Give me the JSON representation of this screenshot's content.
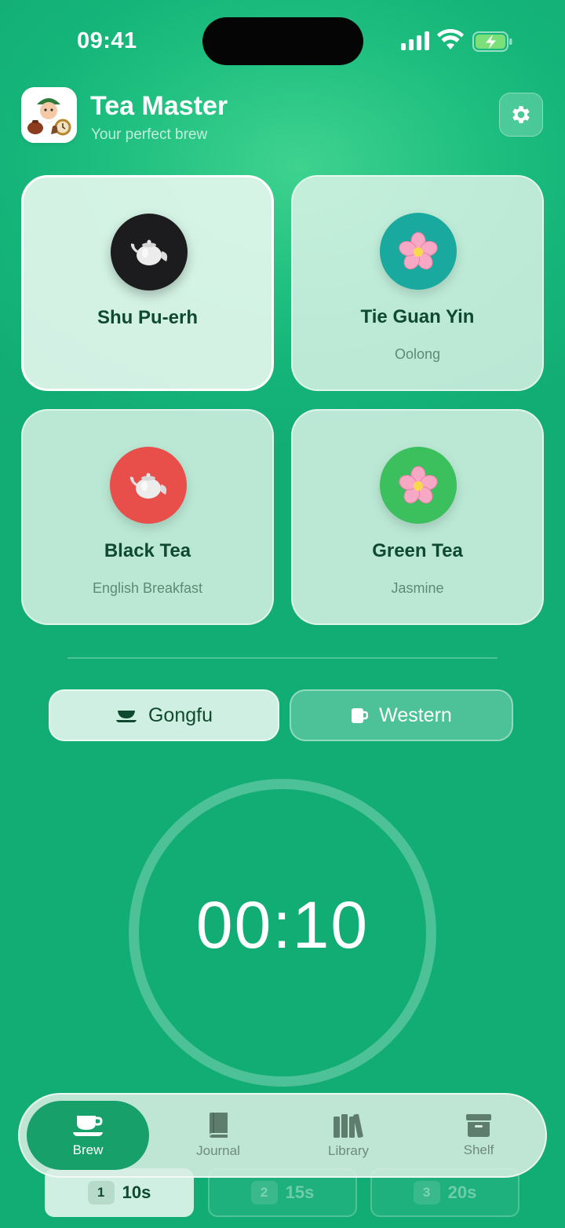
{
  "status": {
    "time": "09:41"
  },
  "header": {
    "title": "Tea Master",
    "subtitle": "Your perfect brew"
  },
  "teas": [
    {
      "name": "Shu Pu-erh",
      "subtitle": "",
      "icon": "teapot-icon",
      "color": "#1c1c1e",
      "selected": true
    },
    {
      "name": "Tie Guan Yin",
      "subtitle": "Oolong",
      "icon": "blossom-icon",
      "color": "#1aa99e",
      "selected": false
    },
    {
      "name": "Black Tea",
      "subtitle": "English Breakfast",
      "icon": "teapot-icon",
      "color": "#e84f4a",
      "selected": false
    },
    {
      "name": "Green Tea",
      "subtitle": "Jasmine",
      "icon": "blossom-icon",
      "color": "#3cbf5d",
      "selected": false
    }
  ],
  "modes": [
    {
      "label": "Gongfu",
      "icon": "tea-bowl-icon",
      "selected": true
    },
    {
      "label": "Western",
      "icon": "mug-icon",
      "selected": false
    }
  ],
  "timer": {
    "display": "00:10"
  },
  "steeps": [
    {
      "number": "1",
      "duration": "10s",
      "active": true
    },
    {
      "number": "2",
      "duration": "15s",
      "active": false
    },
    {
      "number": "3",
      "duration": "20s",
      "active": false
    }
  ],
  "tabs": [
    {
      "label": "Brew",
      "icon": "cup-icon",
      "active": true
    },
    {
      "label": "Journal",
      "icon": "book-icon",
      "active": false
    },
    {
      "label": "Library",
      "icon": "books-icon",
      "active": false
    },
    {
      "label": "Shelf",
      "icon": "archive-box-icon",
      "active": false
    }
  ],
  "colors": {
    "accent": "#18a06b",
    "background": "#1fbf80",
    "text_dark": "#0f4a30"
  }
}
